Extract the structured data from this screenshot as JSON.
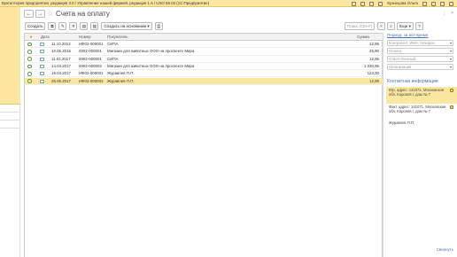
{
  "titlebar": {
    "title": "Бухгалтерия предприятия, редакция 3.0 / Управление нашей фирмой, редакция 1.6 / USO 56.02 (1С:Предприятие)",
    "user": "Кузнецова Ольга"
  },
  "nav": {
    "back": "←",
    "forward": "→"
  },
  "page": {
    "title": "Счета на оплату",
    "star": "☆"
  },
  "window": {
    "more": "⋮",
    "close": "×"
  },
  "toolbar": {
    "create": "Создать",
    "create_basis": "Создать на основании ▾",
    "search_placeholder": "Поиск (Ctrl+F)",
    "more": "Еще ▾",
    "help": "?"
  },
  "table": {
    "columns": [
      "Дата",
      "Номер",
      "Покупатель",
      "Сумма"
    ],
    "rows": [
      {
        "date": "11.10.2012",
        "number": "НФ02-000001",
        "buyer": "СИПА",
        "sum": "12,95"
      },
      {
        "date": "10.05.2016",
        "number": "0002-000001",
        "buyer": "Магазин для животных ООО на проспекте Мира",
        "sum": "45,90"
      },
      {
        "date": "11.04.2017",
        "number": "0002-000001",
        "buyer": "СИПА",
        "sum": "12,95"
      },
      {
        "date": "14.04.2017",
        "number": "0002-000002",
        "buyer": "Магазин для животных ООО на проспекте Мира",
        "sum": "1 230,95"
      },
      {
        "date": "18.04.2017",
        "number": "НФ02-000001",
        "buyer": "Журавлев П.П.",
        "sum": "123,00"
      },
      {
        "date": "25.05.2017",
        "number": "НФ02-000002",
        "buyer": "Журавлев П.П.",
        "sum": "12,95"
      }
    ]
  },
  "side": {
    "period_link": "Период: за все время",
    "combos": [
      "Контрагент, ИНН, телефон",
      "Оплата",
      "Ответственный",
      "Организация"
    ],
    "contact_header": "Контактная информация",
    "cards": [
      {
        "text": "Юр. адрес: 141071, Московская обл, Королев г, дом № 7"
      },
      {
        "text": "Факт. адрес: 141071, Московская обл, Королев г, дом № 7"
      },
      {
        "text": "Журавлев П.П."
      }
    ]
  },
  "bottom": {
    "link": "Свернуть"
  }
}
